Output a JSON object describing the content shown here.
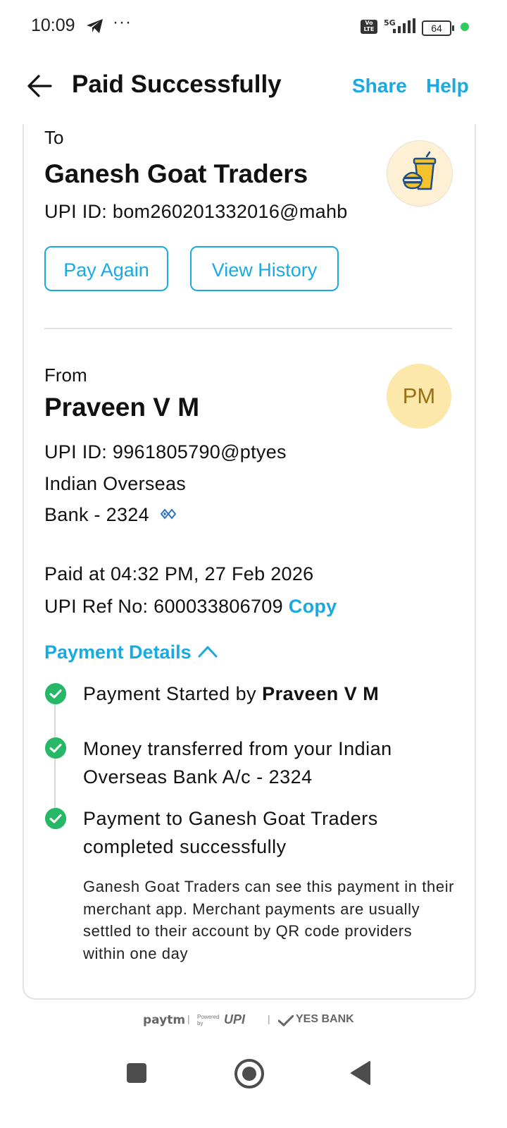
{
  "status_bar": {
    "time": "10:09",
    "more": "···",
    "volte": "Vo LTE",
    "network": "5G",
    "battery": "64"
  },
  "header": {
    "title": "Paid Successfully",
    "share_label": "Share",
    "help_label": "Help"
  },
  "recipient": {
    "label": "To",
    "name": "Ganesh Goat Traders",
    "upi_id": "UPI ID: bom260201332016@mahb"
  },
  "actions": {
    "pay_again": "Pay Again",
    "view_history": "View History"
  },
  "sender": {
    "label": "From",
    "name": "Praveen V M",
    "initials": "PM",
    "upi_id": "UPI ID: 9961805790@ptyes",
    "bank_line1": "Indian Overseas",
    "bank_line2": "Bank - 2324"
  },
  "transaction": {
    "paid_at": "Paid at 04:32 PM, 27 Feb 2026",
    "upi_ref": "UPI Ref No: 600033806709",
    "copy_label": "Copy"
  },
  "payment_details": {
    "toggle_label": "Payment Details",
    "steps": [
      {
        "text": "Payment Started by ",
        "bold": "Praveen V M"
      },
      {
        "text": "Money transferred from your Indian Overseas Bank A/c - 2324"
      },
      {
        "text": "Payment to Ganesh Goat Traders completed successfully"
      }
    ],
    "note": "Ganesh Goat Traders can see this payment in their merchant app. Merchant payments are usually settled to their account by QR code providers within one day"
  },
  "footer": {
    "paytm": "paytm",
    "powered_by": "Powered by",
    "upi": "UPI",
    "bank": "YES BANK"
  },
  "colors": {
    "accent": "#1aa9e0",
    "success": "#27b867",
    "avatar_bg": "#fbe8aa"
  }
}
